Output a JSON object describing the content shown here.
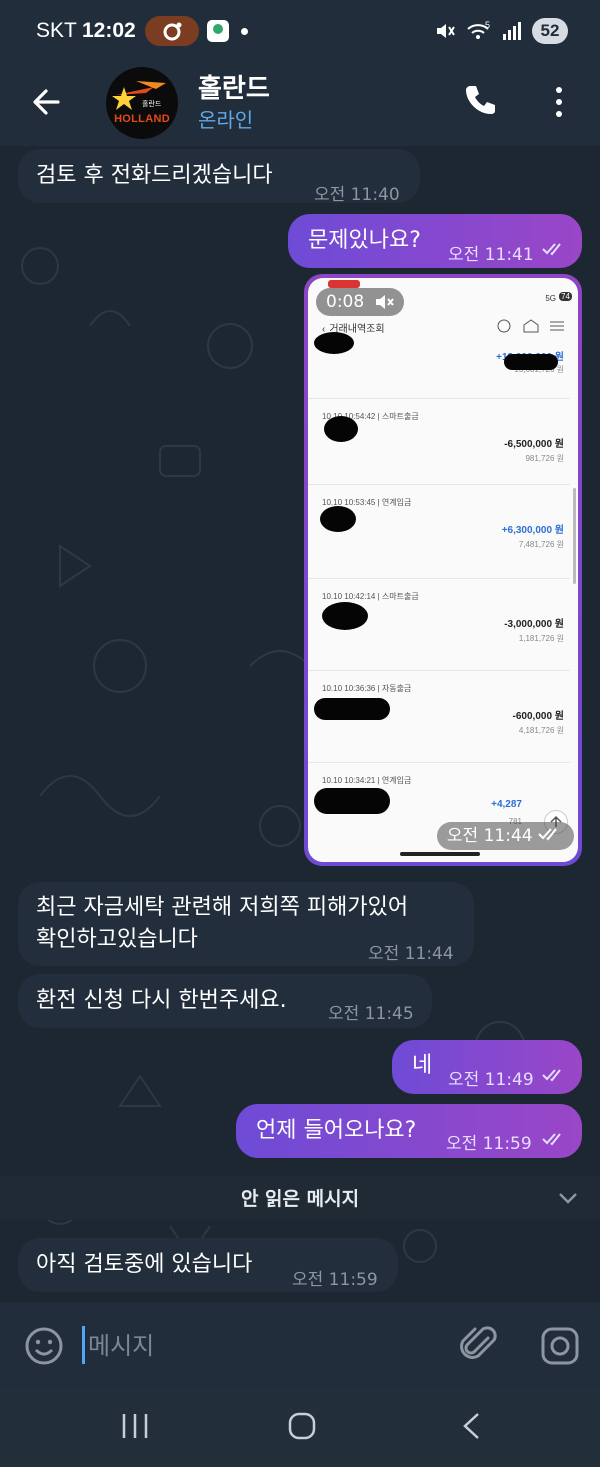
{
  "status_bar": {
    "carrier": "SKT",
    "time": "12:02",
    "battery": "52",
    "network_badge": "5"
  },
  "header": {
    "title": "홀란드",
    "subtitle": "온라인",
    "avatar_brand": "HOLLAND",
    "avatar_sub": "홀란드"
  },
  "messages": [
    {
      "dir": "in",
      "text": "검토 후 전화드리겠습니다",
      "time": "오전 11:40"
    },
    {
      "dir": "out",
      "text": "문제있나요?",
      "time": "오전 11:41"
    },
    {
      "dir": "in",
      "text": "최근 자금세탁 관련해 저희쪽 피해가있어 확인하고있습니다",
      "line1": "최근 자금세탁 관련해 저희쪽 피해가있어",
      "line2": "확인하고있습니다",
      "time": "오전 11:44"
    },
    {
      "dir": "in",
      "text": "환전 신청 다시 한번주세요.",
      "time": "오전 11:45"
    },
    {
      "dir": "out",
      "text": "네",
      "time": "오전 11:49"
    },
    {
      "dir": "out",
      "text": "언제 들어오나요?",
      "time": "오전 11:59"
    },
    {
      "dir": "in",
      "text": "아직 검토중에 있습니다",
      "time": "오전 11:59"
    }
  ],
  "media": {
    "duration": "0:08",
    "time": "오전 11:44",
    "screen_status": "5G",
    "screen_battery": "74",
    "screen_title": "거래내역조회",
    "entries": [
      {
        "stamp": "",
        "amount": "+12,000,000 원",
        "balance": "13,681,726 원"
      },
      {
        "stamp": "10.10 10:54:42 | 스마트출금",
        "amount": "-6,500,000 원",
        "balance": "981,726 원"
      },
      {
        "stamp": "10.10 10:53:45 | 연계입금",
        "amount": "+6,300,000 원",
        "balance": "7,481,726 원"
      },
      {
        "stamp": "10.10 10:42:14 | 스마트출금",
        "amount": "-3,000,000 원",
        "balance": "1,181,726 원"
      },
      {
        "stamp": "10.10 10:36:36 | 자동출금",
        "amount": "-600,000 원",
        "balance": "4,181,726 원"
      },
      {
        "stamp": "10.10 10:34:21 | 연계입금",
        "amount": "+4,287",
        "balance": "781"
      }
    ]
  },
  "unread_divider": "안 읽은 메시지",
  "input": {
    "placeholder": "메시지"
  },
  "colors": {
    "bg": "#1d2732",
    "bar": "#212d3b",
    "incoming": "#222e3b",
    "outgoing_start": "#6e4bd6",
    "outgoing_end": "#9a46c7",
    "accent": "#5fa8e8",
    "plus_amount": "#2d6fd6"
  }
}
